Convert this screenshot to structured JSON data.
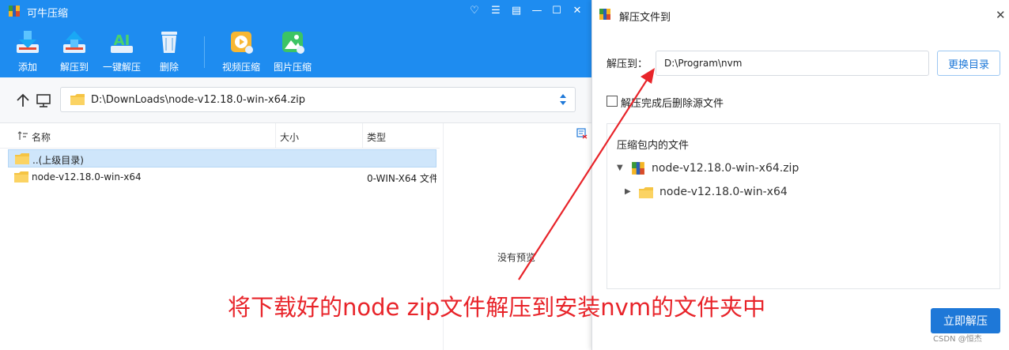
{
  "main_window": {
    "title": "可牛压缩",
    "controls": {
      "favorite": "♡",
      "menu": "☰",
      "feedback": "▤",
      "minimize": "—",
      "maximize": "☐",
      "close": "✕"
    },
    "toolbar": {
      "add": "添加",
      "extract_to": "解压到",
      "one_click_extract": "一键解压",
      "delete": "删除",
      "video_compress": "视频压缩",
      "image_compress": "图片压缩"
    },
    "path": "D:\\DownLoads\\node-v12.18.0-win-x64.zip",
    "columns": {
      "name": "名称",
      "size": "大小",
      "type": "类型"
    },
    "rows": [
      {
        "name": "..(上级目录)",
        "type": ""
      },
      {
        "name": "node-v12.18.0-win-x64",
        "type": "0-WIN-X64 文件"
      }
    ],
    "preview_text": "没有预览"
  },
  "dialog": {
    "title": "解压文件到",
    "dest_label": "解压到：",
    "dest_value": "D:\\Program\\nvm",
    "browse_button": "更换目录",
    "delete_after_label": "解压完成后删除源文件",
    "delete_after_checked": false,
    "tree_header": "压缩包内的文件",
    "tree": {
      "archive": "node-v12.18.0-win-x64.zip",
      "folder": "node-v12.18.0-win-x64"
    },
    "extract_button": "立即解压"
  },
  "annotation": {
    "text": "将下载好的node zip文件解压到安装nvm的文件夹中",
    "color": "#e8242a"
  },
  "watermark": "CSDN @恒杰",
  "colors": {
    "accent": "#1e8cf0",
    "selection": "#cfe6fb",
    "button": "#1e78d8"
  }
}
